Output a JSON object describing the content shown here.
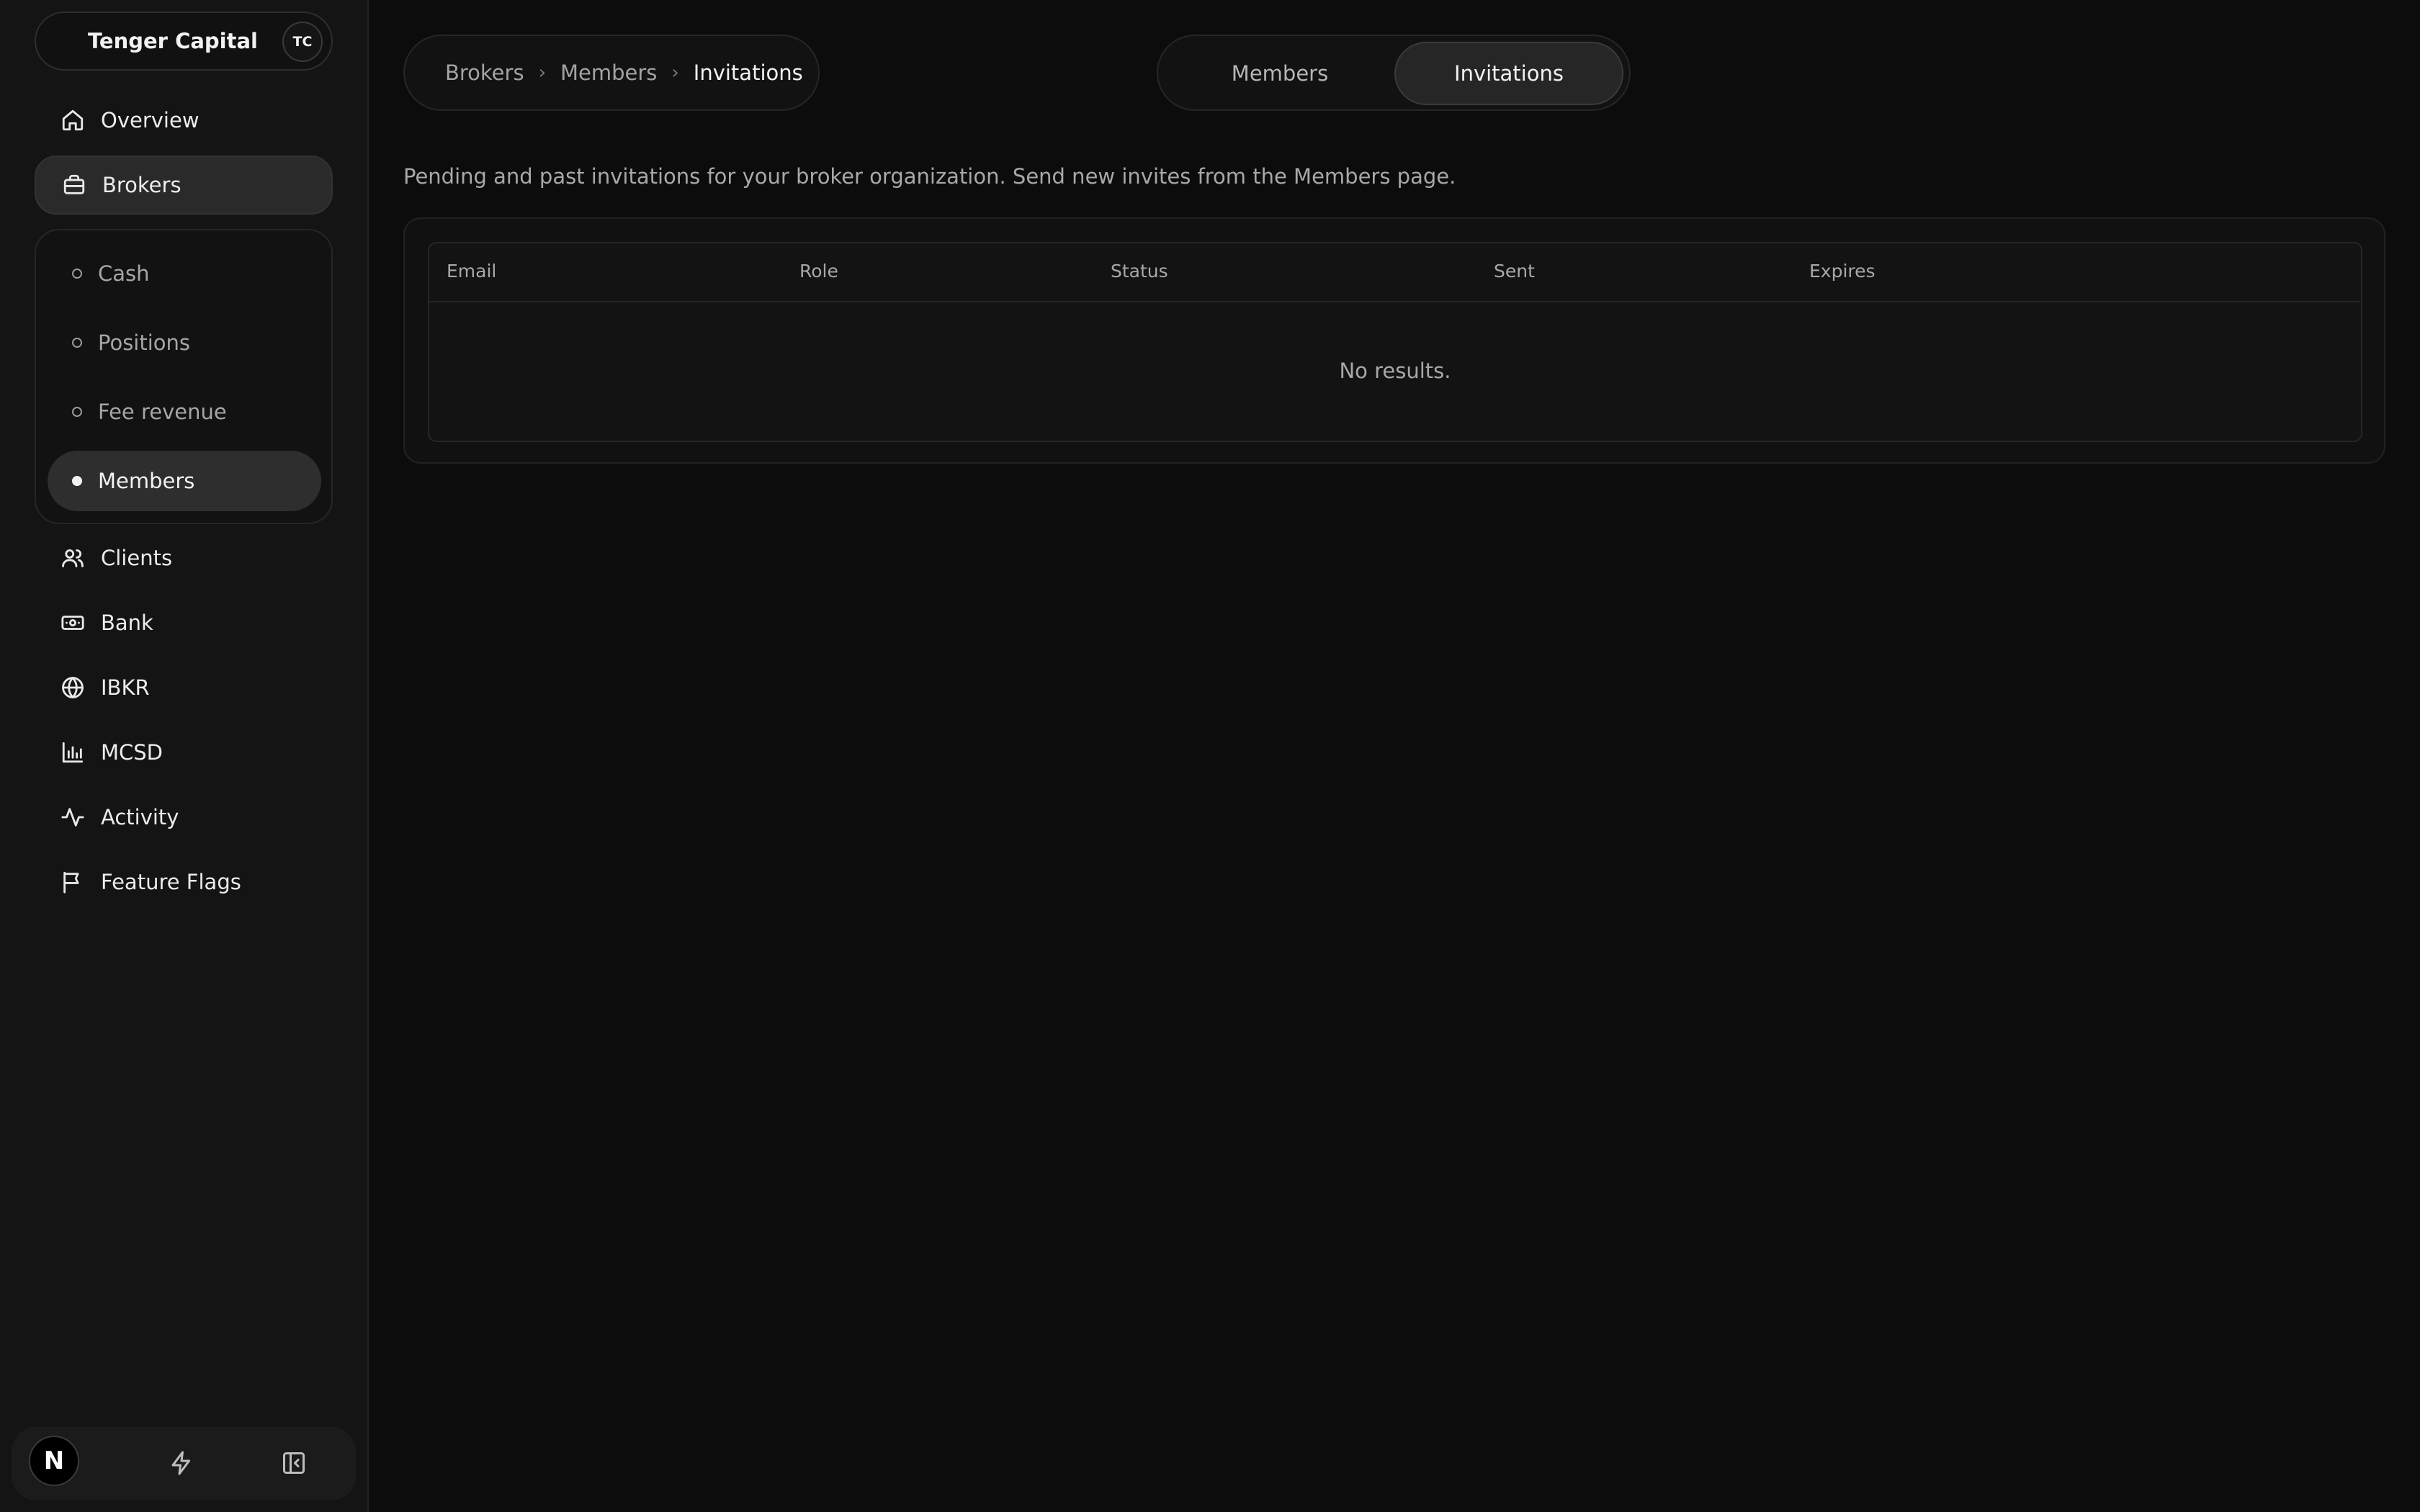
{
  "org": {
    "name": "Tenger Capital",
    "avatar": "TC"
  },
  "sidebar": {
    "items": [
      {
        "label": "Overview",
        "icon": "home-icon"
      },
      {
        "label": "Brokers",
        "icon": "briefcase-icon",
        "active": true
      },
      {
        "label": "Clients",
        "icon": "users-icon"
      },
      {
        "label": "Bank",
        "icon": "banknote-icon"
      },
      {
        "label": "IBKR",
        "icon": "globe-icon"
      },
      {
        "label": "MCSD",
        "icon": "bar-chart-icon"
      },
      {
        "label": "Activity",
        "icon": "activity-icon"
      },
      {
        "label": "Feature Flags",
        "icon": "flag-icon"
      }
    ],
    "subitems": [
      {
        "label": "Cash"
      },
      {
        "label": "Positions"
      },
      {
        "label": "Fee revenue"
      },
      {
        "label": "Members",
        "active": true
      }
    ],
    "footer": {
      "avatar_letter": "N"
    }
  },
  "breadcrumb": {
    "items": [
      "Brokers",
      "Members",
      "Invitations"
    ]
  },
  "tabs": [
    {
      "label": "Members"
    },
    {
      "label": "Invitations",
      "active": true
    }
  ],
  "description": "Pending and past invitations for your broker organization. Send new invites from the Members page.",
  "table": {
    "columns": [
      "Email",
      "Role",
      "Status",
      "Sent",
      "Expires"
    ],
    "empty_message": "No results."
  }
}
